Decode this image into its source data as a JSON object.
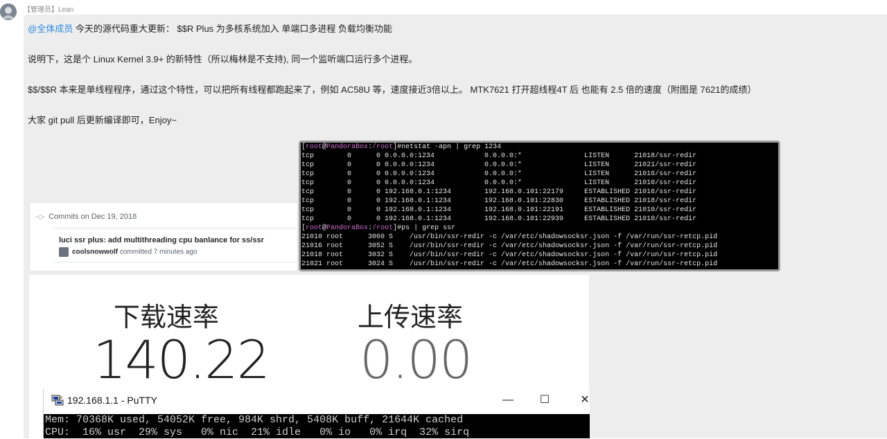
{
  "post": {
    "author": "【管理员】Lean",
    "mention": "@全体成员",
    "line1_rest": " 今天的源代码重大更新： $$R Plus 为多核系统加入 单端口多进程 负载均衡功能",
    "line2": "说明下，这是个 Linux Kernel 3.9+ 的新特性（所以梅林是不支持), 同一个监听端口运行多个进程。",
    "line3": "$$/$$R 本来是单线程程序，通过这个特性，可以把所有线程都跑起来了，例如 AC58U 等，速度接近3倍以上。 MTK7621 打开超线程4T 后 也能有 2.5 倍的速度（附图是 7621的成绩）",
    "line4": "大家 git pull 后更新编译即可，Enjoy~"
  },
  "commits": {
    "header": "Commits on Dec 19, 2018",
    "title": "luci ssr plus: add multithreading cpu banlance for ss/ssr",
    "user": "coolsnowwolf",
    "meta": " committed 7 minutes ago"
  },
  "terminal": {
    "prompt1": {
      "user": "root",
      "host": "PandoraBox",
      "path": "/root",
      "cmd": "#netstat -apn | grep 1234"
    },
    "netstat": [
      "tcp        0      0 0.0.0.0:1234            0.0.0.0:*               LISTEN      21018/ssr-redir",
      "tcp        0      0 0.0.0.0:1234            0.0.0.0:*               LISTEN      21021/ssr-redir",
      "tcp        0      0 0.0.0.0:1234            0.0.0.0:*               LISTEN      21016/ssr-redir",
      "tcp        0      0 0.0.0.0:1234            0.0.0.0:*               LISTEN      21010/ssr-redir",
      "tcp        0      0 192.168.0.1:1234        192.168.0.101:22179     ESTABLISHED 21016/ssr-redir",
      "tcp        0      0 192.168.0.1:1234        192.168.0.101:22830     ESTABLISHED 21018/ssr-redir",
      "tcp        0      0 192.168.0.1:1234        192.168.0.101:22191     ESTABLISHED 21010/ssr-redir",
      "tcp        0      0 192.168.0.1:1234        192.168.0.101:22939     ESTABLISHED 21010/ssr-redir"
    ],
    "prompt2": {
      "user": "root",
      "host": "PandoraBox",
      "path": "/root",
      "cmd": "#ps | grep ssr"
    },
    "ps": [
      "21010 root      3060 S    /usr/bin/ssr-redir -c /var/etc/shadowsocksr.json -f /var/run/ssr-retcp.pid",
      "21016 root      3052 S    /usr/bin/ssr-redir -c /var/etc/shadowsocksr.json -f /var/run/ssr-retcp.pid",
      "21018 root      3032 S    /usr/bin/ssr-redir -c /var/etc/shadowsocksr.json -f /var/run/ssr-retcp.pid",
      "21021 root      3024 S    /usr/bin/ssr-redir -c /var/etc/shadowsocksr.json -f /var/run/ssr-retcp.pid"
    ]
  },
  "speed": {
    "download_label": "下载速率",
    "download_value": "140.22",
    "upload_label": "上传速率",
    "upload_value": "0.00"
  },
  "putty": {
    "title": "192.168.1.1 - PuTTY",
    "minimize": "—",
    "maximize": "☐",
    "close": "✕",
    "line1": "Mem: 70368K used, 54052K free, 984K shrd, 5408K buff, 21644K cached",
    "line2": "CPU:  16% usr  29% sys   0% nic  21% idle   0% io   0% irq  32% sirq"
  }
}
